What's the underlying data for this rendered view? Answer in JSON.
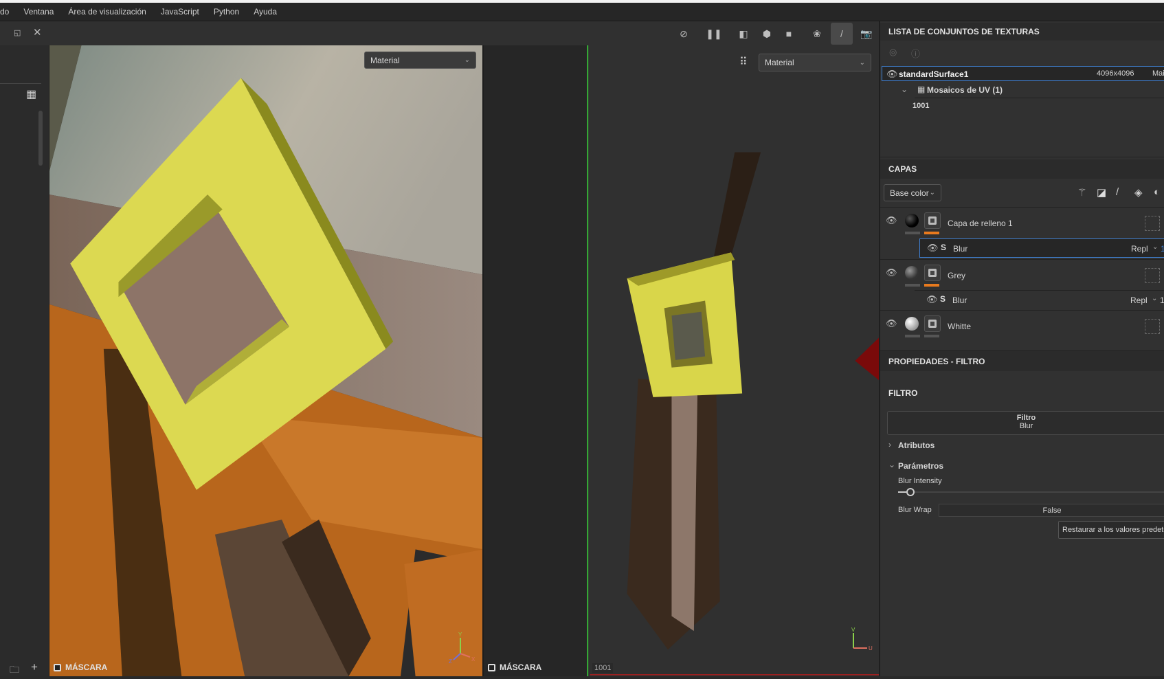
{
  "menu": [
    "do",
    "Ventana",
    "Área de visualización",
    "JavaScript",
    "Python",
    "Ayuda"
  ],
  "viewport_left": {
    "dropdown": "Material",
    "mask_label": "MÁSCARA",
    "axes": [
      "Y",
      "X",
      "Z"
    ]
  },
  "viewport_right": {
    "dropdown": "Material",
    "mask_label": "MÁSCARA",
    "uv_tile": "1001",
    "axes": [
      "V",
      "U"
    ]
  },
  "toolbar_icons": [
    "hide-icon",
    "pause-icon",
    "symmetry-icon",
    "cube-icon",
    "camera-icon",
    "bake-icon",
    "paint-brush-icon",
    "screenshot-icon"
  ],
  "texture_sets": {
    "title": "LISTA DE CONJUNTOS DE TEXTURAS",
    "items": [
      {
        "name": "standardSurface1",
        "resolution": "4096x4096",
        "shader": "Mai"
      }
    ],
    "uv_group": "Mosaicos de UV (1)",
    "uv_tiles": [
      "1001"
    ]
  },
  "layers": {
    "title": "CAPAS",
    "channel": "Base color",
    "items": [
      {
        "name": "Capa de relleno 1",
        "sphere": "black",
        "effect": {
          "name": "Blur",
          "blend": "Repl",
          "opacity": "1"
        }
      },
      {
        "name": "Grey",
        "sphere": "grey",
        "effect": {
          "name": "Blur",
          "blend": "Repl",
          "opacity": "1"
        }
      },
      {
        "name": "Whitte",
        "sphere": "white"
      }
    ]
  },
  "properties": {
    "title": "PROPIEDADES - FILTRO",
    "section": "FILTRO",
    "filter_label": "Filtro",
    "filter_value": "Blur",
    "attributes": "Atributos",
    "parameters": "Parámetros",
    "blur_intensity_label": "Blur Intensity",
    "blur_intensity": 0.03,
    "blur_wrap_label": "Blur Wrap",
    "blur_wrap": "False",
    "reset_button": "Restaurar a los valores predete"
  },
  "colors": {
    "accent": "#3f7fd0",
    "orange": "#e87a1e",
    "yellow": "#d6d23a"
  }
}
